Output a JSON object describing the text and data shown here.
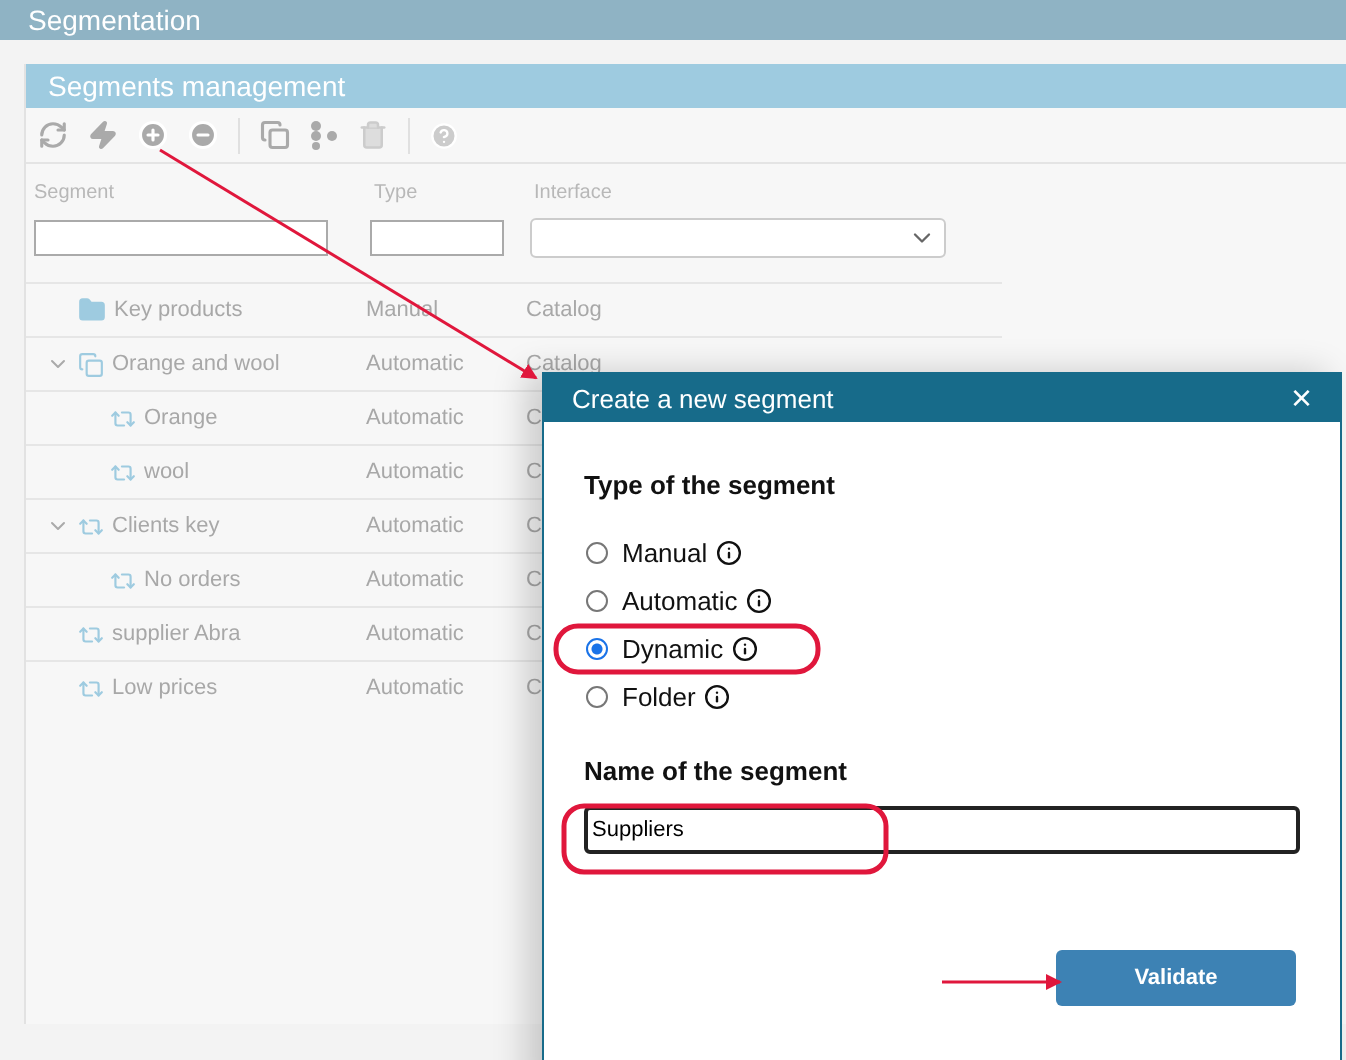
{
  "page_title": "Segmentation",
  "panel": {
    "title": "Segments management",
    "columns": [
      {
        "label": "Segment"
      },
      {
        "label": "Type"
      },
      {
        "label": "Interface"
      }
    ],
    "rows": [
      {
        "name": "Key products",
        "kind": "folder",
        "type": "Manual",
        "interface": "Catalog"
      },
      {
        "name": "Orange and wool",
        "kind": "group",
        "type": "Automatic",
        "interface": "Catalog",
        "expanded": true,
        "children": [
          {
            "name": "Orange",
            "kind": "segment",
            "type": "Automatic",
            "interface": "C"
          },
          {
            "name": "wool",
            "kind": "segment",
            "type": "Automatic",
            "interface": "C"
          }
        ]
      },
      {
        "name": "Clients key",
        "kind": "segment",
        "type": "Automatic",
        "interface": "C",
        "expanded": true,
        "children": [
          {
            "name": "No orders",
            "kind": "segment",
            "type": "Automatic",
            "interface": "C"
          }
        ]
      },
      {
        "name": "supplier Abra",
        "kind": "segment",
        "type": "Automatic",
        "interface": "C"
      },
      {
        "name": "Low prices",
        "kind": "segment",
        "type": "Automatic",
        "interface": "C"
      }
    ]
  },
  "dialog": {
    "title": "Create a new segment",
    "close": "×",
    "type_heading": "Type of the segment",
    "options": [
      {
        "label": "Manual",
        "selected": false
      },
      {
        "label": "Automatic",
        "selected": false
      },
      {
        "label": "Dynamic",
        "selected": true
      },
      {
        "label": "Folder",
        "selected": false
      }
    ],
    "name_heading": "Name of the segment",
    "name_value": "Suppliers",
    "button": "Validate"
  }
}
